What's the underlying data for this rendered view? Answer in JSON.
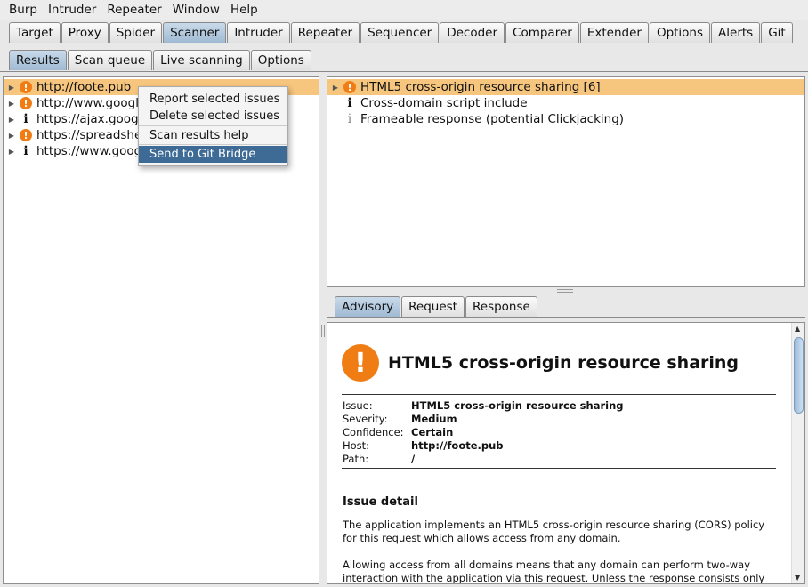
{
  "menu": [
    "Burp",
    "Intruder",
    "Repeater",
    "Window",
    "Help"
  ],
  "main_tabs": [
    "Target",
    "Proxy",
    "Spider",
    "Scanner",
    "Intruder",
    "Repeater",
    "Sequencer",
    "Decoder",
    "Comparer",
    "Extender",
    "Options",
    "Alerts",
    "Git"
  ],
  "sub_tabs": [
    "Results",
    "Scan queue",
    "Live scanning",
    "Options"
  ],
  "hosts": [
    "http://foote.pub",
    "http://www.google",
    "https://ajax.googl",
    "https://spreadshe",
    "https://www.goog"
  ],
  "context_menu": [
    "Report selected issues",
    "Delete selected issues",
    "Scan results help",
    "Send to Git Bridge"
  ],
  "issues": [
    "HTML5 cross-origin resource sharing [6]",
    "Cross-domain script include",
    "Frameable response (potential Clickjacking)"
  ],
  "detail_tabs": [
    "Advisory",
    "Request",
    "Response"
  ],
  "advisory": {
    "title": "HTML5 cross-origin resource sharing",
    "fields": [
      {
        "k": "Issue:",
        "v": "HTML5 cross-origin resource sharing"
      },
      {
        "k": "Severity:",
        "v": "Medium"
      },
      {
        "k": "Confidence:",
        "v": "Certain"
      },
      {
        "k": "Host:",
        "v": "http://foote.pub"
      },
      {
        "k": "Path:",
        "v": "/"
      }
    ],
    "section": "Issue detail",
    "p1": "The application implements an HTML5 cross-origin resource sharing (CORS) policy for this request which allows access from any domain.",
    "p2": "Allowing access from all domains means that any domain can perform two-way interaction with the application via this request. Unless the response consists only of"
  },
  "colors": {
    "selection": "#f7c67e",
    "active_tab": "#9fbad3",
    "alert": "#f07d14",
    "menu_highlight": "#3d6b96"
  }
}
